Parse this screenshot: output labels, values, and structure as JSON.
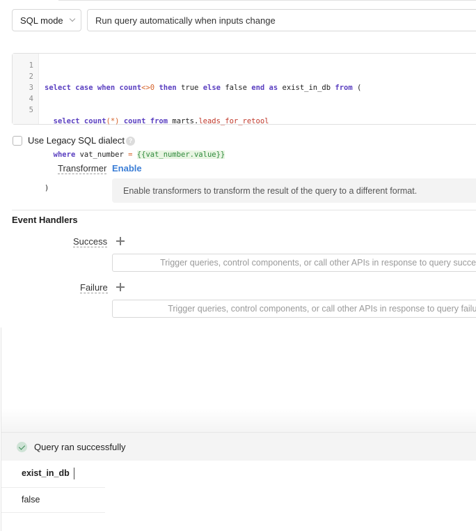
{
  "query": {
    "mode_label": "SQL mode",
    "trigger_label": "Run query automatically when inputs change",
    "line_numbers": [
      "1",
      "2",
      "3",
      "4",
      "5"
    ],
    "code_tokens": {
      "l1": [
        "select",
        "case",
        "when",
        "count",
        "<>",
        "0",
        "then",
        "true",
        "else",
        "false",
        "end",
        "as",
        "exist_in_db",
        "from",
        "("
      ],
      "l2": [
        "select",
        "count",
        "(*)",
        "count",
        "from",
        "marts",
        ".",
        "leads_for_retool"
      ],
      "l3": [
        "where",
        "vat_number",
        "=",
        "{{vat_number.value}}"
      ],
      "l4": [
        ")"
      ]
    }
  },
  "legacy_sql": {
    "label": "Use Legacy SQL dialect",
    "checked": false,
    "help_icon": "?"
  },
  "transformer": {
    "label": "Transformer",
    "action": "Enable",
    "description": "Enable transformers to transform the result of the query to a different format."
  },
  "event_handlers": {
    "title": "Event Handlers",
    "success_label": "Success",
    "success_placeholder": "Trigger queries, control components, or call other APIs in response to query success.",
    "failure_label": "Failure",
    "failure_placeholder": "Trigger queries, control components, or call other APIs in response to query failure."
  },
  "status": {
    "icon": "check-circle-icon",
    "text": "Query ran successfully"
  },
  "results": {
    "columns": [
      "exist_in_db"
    ],
    "rows": [
      [
        "false"
      ]
    ]
  }
}
